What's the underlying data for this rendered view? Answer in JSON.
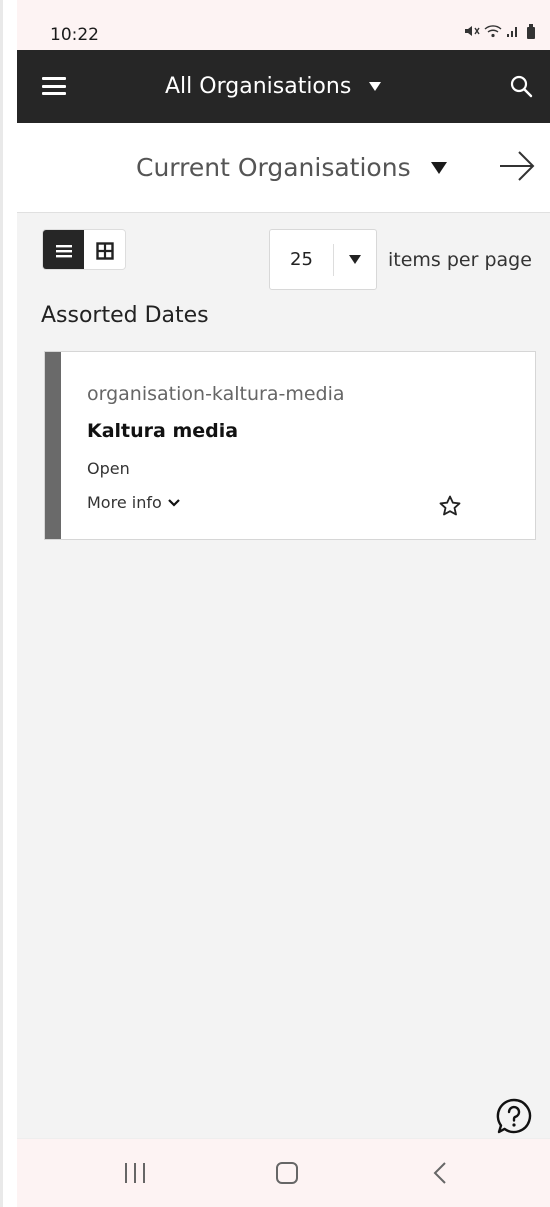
{
  "status_bar": {
    "time": "10:22",
    "icons": [
      "mute-icon",
      "wifi-icon",
      "signal-icon",
      "battery-icon"
    ]
  },
  "app_bar": {
    "title": "All Organisations",
    "menu_icon": "hamburger-icon",
    "search_icon": "search-icon"
  },
  "sub_header": {
    "title": "Current Organisations",
    "next_icon": "arrow-right-icon"
  },
  "toolbar": {
    "view_modes": [
      "list-view-icon",
      "grid-view-icon"
    ],
    "active_view": "list",
    "per_page_value": "25",
    "per_page_label": "items per page"
  },
  "section": {
    "heading": "Assorted Dates"
  },
  "cards": [
    {
      "slug": "organisation-kaltura-media",
      "name": "Kaltura media",
      "status": "Open",
      "more_label": "More info",
      "favorite": false
    }
  ],
  "help_icon": "help-question-icon",
  "nav_bar": {
    "items": [
      "recents-icon",
      "home-icon",
      "back-icon"
    ]
  },
  "colors": {
    "app_bar_bg": "#262626",
    "content_bg": "#f3f3f3",
    "card_accent": "#6a6a6a",
    "system_bar_bg": "#fdf3f3"
  }
}
